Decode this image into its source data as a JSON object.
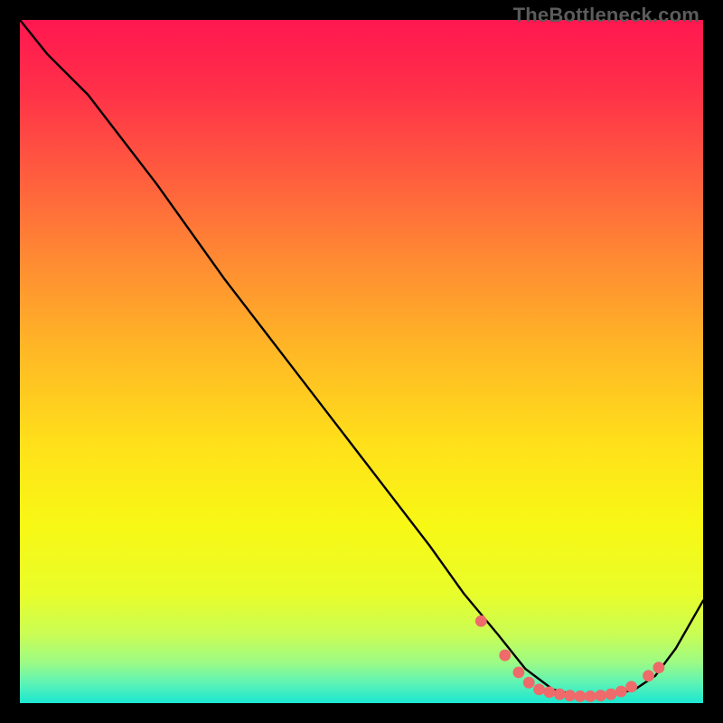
{
  "watermark": "TheBottleneck.com",
  "chart_data": {
    "type": "line",
    "title": "",
    "xlabel": "",
    "ylabel": "",
    "xlim": [
      0,
      100
    ],
    "ylim": [
      0,
      100
    ],
    "series": [
      {
        "name": "bottleneck-curve",
        "x": [
          0,
          4,
          10,
          20,
          30,
          40,
          50,
          60,
          65,
          70,
          74,
          78,
          82,
          86,
          90,
          93,
          96,
          100
        ],
        "y": [
          100,
          95,
          89,
          76,
          62,
          49,
          36,
          23,
          16,
          10,
          5,
          2,
          1,
          1,
          2,
          4,
          8,
          15
        ]
      }
    ],
    "markers": {
      "name": "optimal-dots",
      "color": "#ef6a6a",
      "points": [
        {
          "x": 67.5,
          "y": 12.0
        },
        {
          "x": 71.0,
          "y": 7.0
        },
        {
          "x": 73.0,
          "y": 4.5
        },
        {
          "x": 74.5,
          "y": 3.0
        },
        {
          "x": 76.0,
          "y": 2.0
        },
        {
          "x": 77.5,
          "y": 1.6
        },
        {
          "x": 79.0,
          "y": 1.3
        },
        {
          "x": 80.5,
          "y": 1.1
        },
        {
          "x": 82.0,
          "y": 1.0
        },
        {
          "x": 83.5,
          "y": 1.0
        },
        {
          "x": 85.0,
          "y": 1.1
        },
        {
          "x": 86.5,
          "y": 1.3
        },
        {
          "x": 88.0,
          "y": 1.7
        },
        {
          "x": 89.5,
          "y": 2.4
        },
        {
          "x": 92.0,
          "y": 4.0
        },
        {
          "x": 93.5,
          "y": 5.2
        }
      ]
    },
    "background_gradient_stops": [
      {
        "offset": 0.0,
        "color": "#ff1750"
      },
      {
        "offset": 0.1,
        "color": "#ff2f49"
      },
      {
        "offset": 0.22,
        "color": "#ff5a3f"
      },
      {
        "offset": 0.35,
        "color": "#ff8a33"
      },
      {
        "offset": 0.48,
        "color": "#ffb626"
      },
      {
        "offset": 0.62,
        "color": "#ffe01a"
      },
      {
        "offset": 0.74,
        "color": "#f8f815"
      },
      {
        "offset": 0.84,
        "color": "#e8fd2a"
      },
      {
        "offset": 0.9,
        "color": "#c9fd55"
      },
      {
        "offset": 0.94,
        "color": "#9dfb84"
      },
      {
        "offset": 0.97,
        "color": "#5ef3b5"
      },
      {
        "offset": 1.0,
        "color": "#1be7d0"
      }
    ]
  }
}
